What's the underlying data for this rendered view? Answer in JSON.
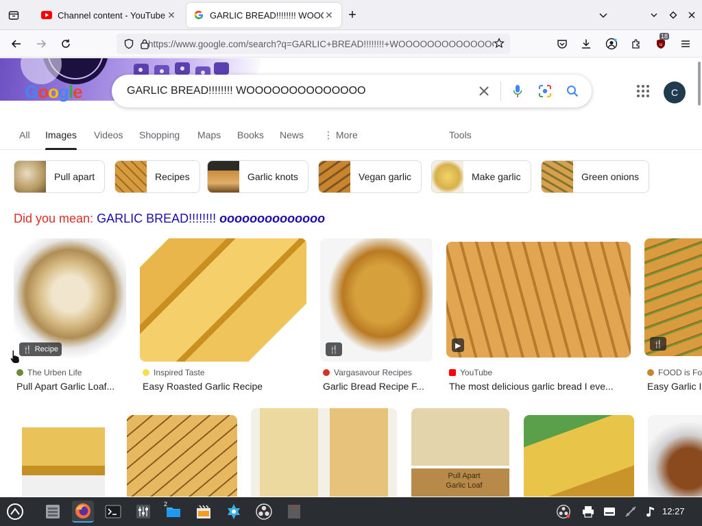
{
  "browser": {
    "tabs": [
      {
        "label": "Channel content - YouTube Studio",
        "active": false,
        "favicon": "youtube-icon"
      },
      {
        "label": "GARLIC BREAD!!!!!!!! WOOOOOOOOOOOOOO",
        "active": true,
        "favicon": "google-icon"
      }
    ],
    "new_tab_label": "+",
    "url": "https://www.google.com/search?q=GARLIC+BREAD!!!!!!!!+WOOOOOOOOOOOOOO",
    "extension_badge": "18"
  },
  "google": {
    "logo_text": "Google",
    "query": "GARLIC BREAD!!!!!!!! WOOOOOOOOOOOOOO",
    "account_initial": "C",
    "tabs": [
      "All",
      "Images",
      "Videos",
      "Shopping",
      "Maps",
      "Books",
      "News",
      "More",
      "Tools"
    ],
    "chips": [
      "Pull apart",
      "Recipes",
      "Garlic knots",
      "Vegan garlic",
      "Make garlic",
      "Green onions"
    ],
    "did_you_mean": {
      "label": "Did you mean:",
      "query": "GARLIC BREAD!!!!!!!!",
      "correction": "oooooooooooooo"
    },
    "results": [
      {
        "source": "The Urben Life",
        "title": "Pull Apart Garlic Loaf...",
        "badge": "Recipe"
      },
      {
        "source": "Inspired Taste",
        "title": "Easy Roasted Garlic Recipe",
        "badge": ""
      },
      {
        "source": "Vargasavour Recipes",
        "title": "Garlic Bread Recipe F...",
        "badge": ""
      },
      {
        "source": "YouTube",
        "title": "The most delicious garlic bread I eve...",
        "badge": ""
      },
      {
        "source": "FOOD is Fo",
        "title": "Easy Garlic I",
        "badge": ""
      }
    ],
    "row2_overlay_text": "Pull Apart Garlic Loaf"
  },
  "taskbar": {
    "clock": "12:27",
    "files_badge": "2"
  },
  "colors": {
    "accent": "#1a0dab",
    "did_you_mean_red": "#d93025",
    "taskbar_bg": "#2a2e32"
  }
}
